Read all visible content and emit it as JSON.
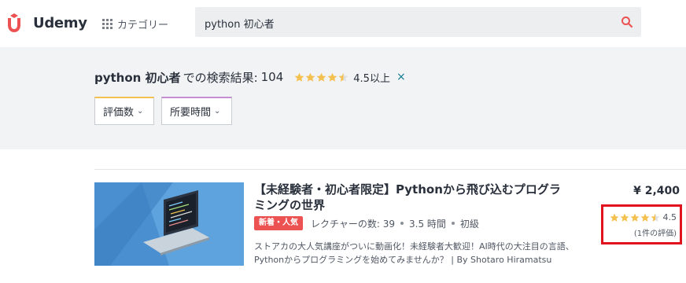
{
  "header": {
    "logo_text": "Udemy",
    "category_label": "カテゴリー",
    "search_value": "python 初心者",
    "accent_color": "#ec5252"
  },
  "results": {
    "query": "python 初心者",
    "suffix": "での検索結果:",
    "count": "104",
    "rating_filter_label": "4.5以上",
    "rating_filter_stars": 4.5,
    "clear_icon": "×"
  },
  "filters": [
    {
      "label": "評価数"
    },
    {
      "label": "所要時間"
    }
  ],
  "course": {
    "title": "【未経験者・初心者限定】Pythonから飛び込むプログラミングの世界",
    "badge": "新着・人気",
    "lectures": "レクチャーの数: 39",
    "duration": "3.5 時間",
    "level": "初級",
    "description": "ストアカの大人気講座がついに動画化！未経験者大歓迎！AI時代の大注目の言語、Pythonからプログラミングを始めてみませんか？ | By Shotaro Hiramatsu",
    "price": "¥ 2,400",
    "rating_value": "4.5",
    "rating_stars": 4.5,
    "rating_count": "(1件の評価)",
    "highlight_color": "#e0141e"
  }
}
